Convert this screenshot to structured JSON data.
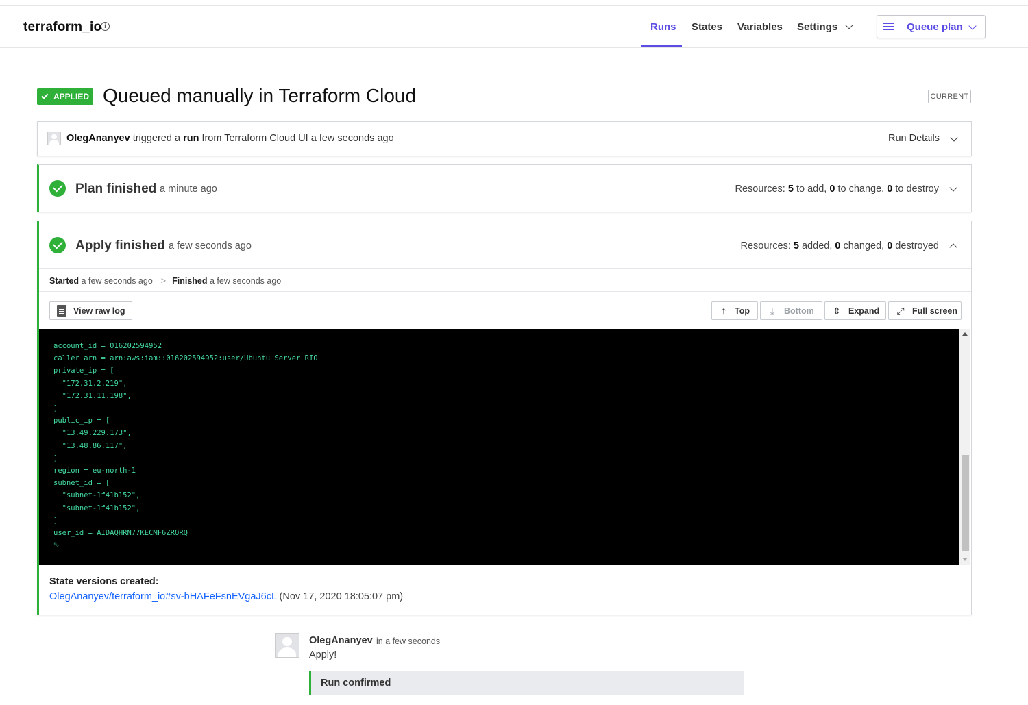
{
  "header": {
    "workspace_name": "terraform_io",
    "nav": [
      {
        "label": "Runs",
        "active": true
      },
      {
        "label": "States"
      },
      {
        "label": "Variables"
      },
      {
        "label": "Settings"
      }
    ],
    "queue_plan_label": "Queue plan",
    "accent_color": "#5c4ee5"
  },
  "run": {
    "status_badge": "APPLIED",
    "status_color": "#2eb039",
    "title": "Queued manually in Terraform Cloud",
    "current_badge": "CURRENT"
  },
  "trigger": {
    "user": "OlegAnanyev",
    "text_1": " triggered a ",
    "run_word": "run",
    "text_2": " from Terraform Cloud UI a few seconds ago",
    "run_details_label": "Run Details"
  },
  "plan": {
    "title": "Plan finished",
    "time": "a minute ago",
    "resources_label": "Resources: ",
    "add": "5",
    "add_label": " to add, ",
    "change": "0",
    "change_label": " to change, ",
    "destroy": "0",
    "destroy_label": " to destroy"
  },
  "apply": {
    "title": "Apply finished",
    "time": "a few seconds ago",
    "resources_label": "Resources: ",
    "added": "5",
    "added_label": " added, ",
    "changed": "0",
    "changed_label": " changed, ",
    "destroyed": "0",
    "destroyed_label": " destroyed",
    "started_label": "Started",
    "started_time": " a few seconds ago",
    "sep": ">",
    "finished_label": "Finished",
    "finished_time": " a few seconds ago",
    "buttons": {
      "view_raw_log": "View raw log",
      "top": "Top",
      "bottom": "Bottom",
      "expand": "Expand",
      "full_screen": "Full screen"
    },
    "log_lines": [
      "account_id = 016202594952",
      "caller_arn = arn:aws:iam::016202594952:user/Ubuntu_Server_RIO",
      "private_ip = [",
      "  \"172.31.2.219\",",
      "  \"172.31.11.198\",",
      "]",
      "public_ip = [",
      "  \"13.49.229.173\",",
      "  \"13.48.86.117\",",
      "]",
      "region = eu-north-1",
      "subnet_id = [",
      "  \"subnet-1f41b152\",",
      "  \"subnet-1f41b152\",",
      "]",
      "user_id = AIDAQHRN77KECMF6ZRORQ",
      "␛"
    ],
    "state_versions_title": "State versions created:",
    "state_version_link": "OlegAnanyev/terraform_io#sv-bHAFeFsnEVgaJ6cL",
    "state_version_date": " (Nov 17, 2020 18:05:07 pm)"
  },
  "comment": {
    "user": "OlegAnanyev",
    "time": "in a few seconds",
    "body": "Apply!",
    "confirmed_label": "Run confirmed"
  }
}
